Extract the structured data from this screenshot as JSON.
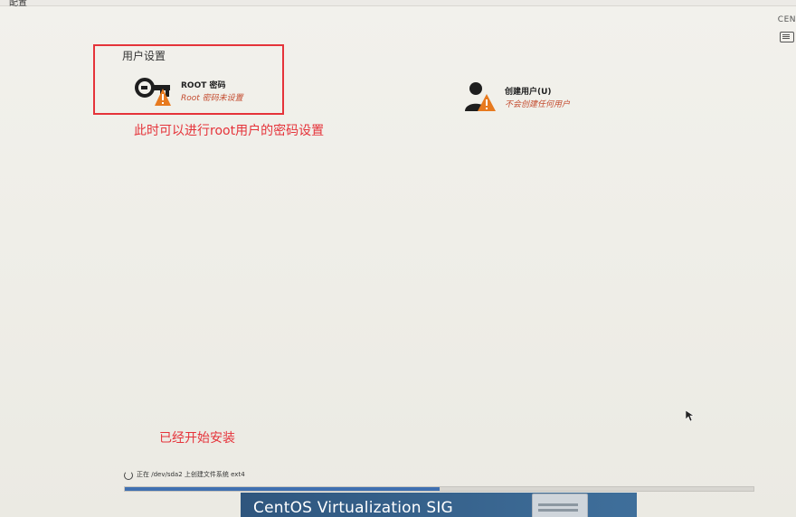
{
  "top": {
    "left_title": "配置",
    "right_label": "CEN"
  },
  "user_settings": {
    "section_title": "用户设置",
    "root": {
      "title": "ROOT 密码",
      "status": "Root 密码未设置"
    },
    "create_user": {
      "title": "创建用户(U)",
      "status": "不会创建任何用户"
    }
  },
  "annotations": {
    "root_note": "此时可以进行root用户的密码设置",
    "install_note": "已经开始安装"
  },
  "progress": {
    "text": "正在 /dev/sda2 上创建文件系统 ext4",
    "fraction": 0.5
  },
  "banner": {
    "text": "CentOS Virtualization SIG"
  },
  "colors": {
    "annotation": "#e5333a",
    "warning": "#e77a1f",
    "status": "#c44c2f",
    "progress": "#3f6fb0"
  },
  "icons": {
    "root": "key-icon",
    "warning": "warning-icon",
    "user": "user-icon",
    "keyboard": "keyboard-icon",
    "cursor": "mouse-cursor-icon"
  }
}
